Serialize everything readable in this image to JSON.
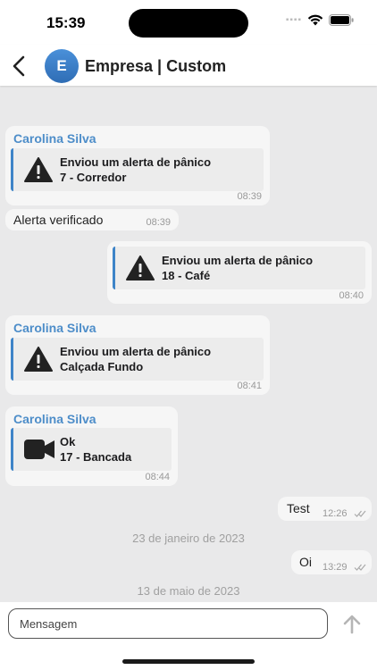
{
  "status_bar": {
    "time": "15:39",
    "dots": "▪▪▪▪"
  },
  "header": {
    "avatar_letter": "E",
    "title": "Empresa | Custom"
  },
  "messages": [
    {
      "sender": "Carolina Silva",
      "line1": "Enviou um alerta de pânico",
      "line2": "7 - Corredor",
      "time": "08:39",
      "icon": "warning-icon"
    },
    {
      "text": "Alerta verificado",
      "time": "08:39"
    },
    {
      "line1": "Enviou um alerta de pânico",
      "line2": "18 - Café",
      "time": "08:40",
      "icon": "warning-icon"
    },
    {
      "sender": "Carolina Silva",
      "line1": "Enviou um alerta de pânico",
      "line2": "Calçada Fundo",
      "time": "08:41",
      "icon": "warning-icon"
    },
    {
      "sender": "Carolina Silva",
      "line1": "Ok",
      "line2": "17 - Bancada",
      "time": "08:44",
      "icon": "video-camera-icon"
    },
    {
      "text": "Test",
      "time": "12:26",
      "status": "read-checks-icon"
    },
    {
      "date": "23 de janeiro de 2023"
    },
    {
      "text": "Oi",
      "time": "13:29",
      "status": "read-checks-icon"
    },
    {
      "date": "13 de maio de 2023"
    }
  ],
  "composer": {
    "placeholder": "Mensagem"
  }
}
